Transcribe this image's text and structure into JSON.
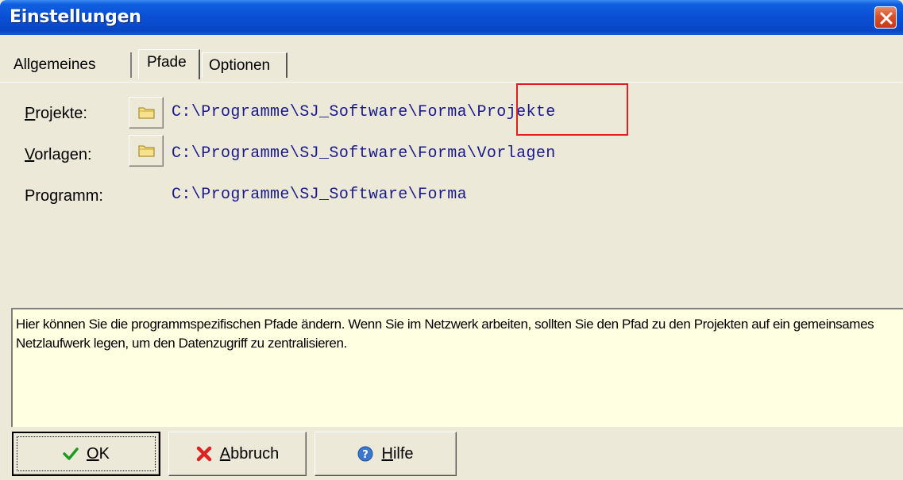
{
  "window": {
    "title": "Einstellungen"
  },
  "tabs": [
    {
      "label": "Allgemeines",
      "active": false
    },
    {
      "label": "Pfade",
      "active": true
    },
    {
      "label": "Optionen",
      "active": false
    }
  ],
  "paths": {
    "projekte": {
      "label_hotkey": "P",
      "label_rest": "rojekte:",
      "value": "C:\\Programme\\SJ_Software\\Forma\\Projekte"
    },
    "vorlagen": {
      "label_hotkey": "V",
      "label_rest": "orlagen:",
      "value": "C:\\Programme\\SJ_Software\\Forma\\Vorlagen"
    },
    "programm": {
      "label": "Programm:",
      "value": "C:\\Programme\\SJ_Software\\Forma"
    }
  },
  "help": {
    "text": "Hier können Sie die programmspezifischen Pfade ändern. Wenn Sie im Netzwerk arbeiten, sollten Sie den Pfad zu den Projekten auf ein gemeinsames Netzlaufwerk legen, um den Datenzugriff zu zentralisieren."
  },
  "buttons": {
    "ok": {
      "hotkey": "O",
      "rest": "K"
    },
    "abbruch": {
      "hotkey": "A",
      "rest": "bbruch"
    },
    "hilfe": {
      "hotkey": "H",
      "rest": "ilfe"
    }
  },
  "colors": {
    "title_bar": "#0a4fd4",
    "path_text": "#1a1a8c",
    "help_bg": "#ffffe1",
    "highlight": "#e02020"
  },
  "icons": {
    "close": "close-icon",
    "folder": "folder-icon",
    "ok": "checkmark-icon",
    "abbruch": "red-x-icon",
    "hilfe": "help-icon"
  }
}
